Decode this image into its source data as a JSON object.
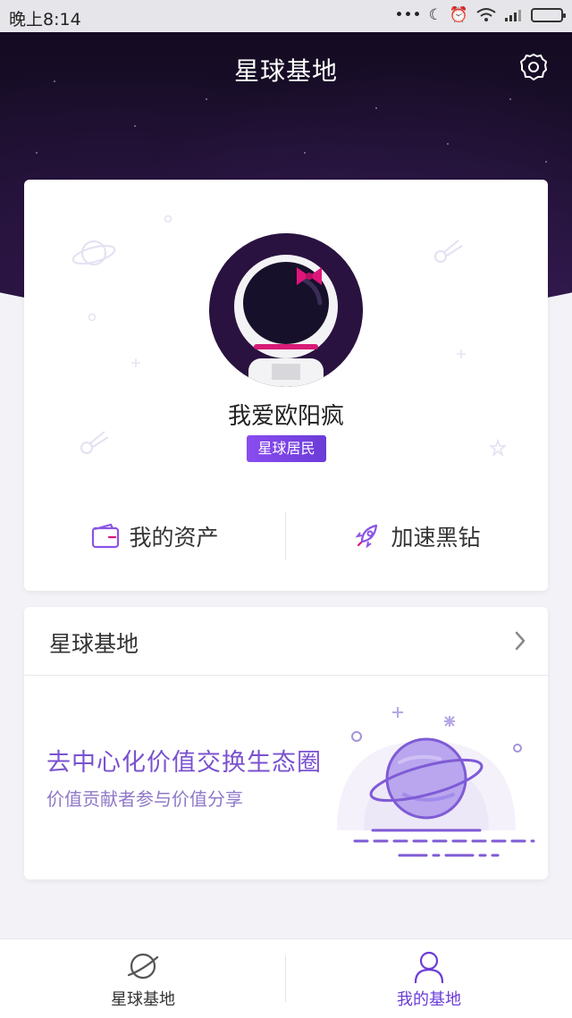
{
  "status_bar": {
    "time": "晚上8:14",
    "icons": [
      "more-dots-icon",
      "moon-icon",
      "alarm-icon",
      "wifi-icon",
      "signal-icon",
      "battery-icon"
    ]
  },
  "header": {
    "title": "星球基地",
    "settings_icon": "gear-icon"
  },
  "profile": {
    "username": "我爱欧阳疯",
    "badge": "星球居民",
    "actions": [
      {
        "label": "我的资产",
        "icon": "wallet-icon"
      },
      {
        "label": "加速黑钻",
        "icon": "rocket-icon"
      }
    ]
  },
  "base_section": {
    "title": "星球基地",
    "promo_title": "去中心化价值交换生态圈",
    "promo_subtitle": "价值贡献者参与价值分享"
  },
  "tabbar": {
    "items": [
      {
        "label": "星球基地",
        "icon": "planet-icon",
        "active": false
      },
      {
        "label": "我的基地",
        "icon": "person-icon",
        "active": true
      }
    ]
  },
  "colors": {
    "accent": "#7a52cf",
    "active_tab": "#6b3cd8",
    "hero_dark": "#150c24",
    "badge": "#7c45e6"
  }
}
